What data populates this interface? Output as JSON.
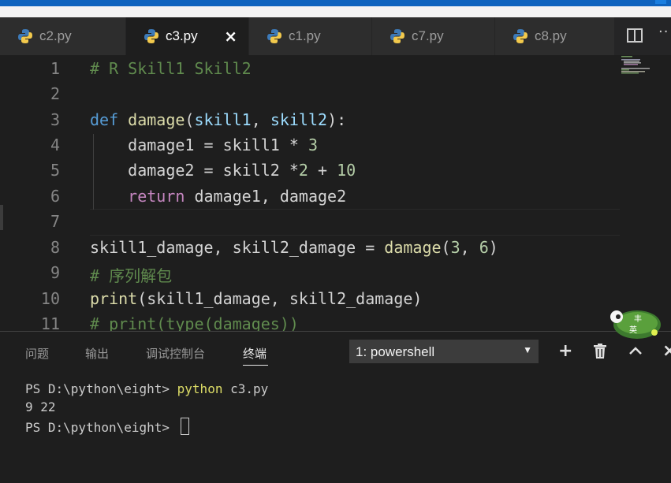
{
  "window": {
    "accent_color": "#0e63be"
  },
  "tabs": [
    {
      "label": "c2.py",
      "icon": "python-icon",
      "active": false
    },
    {
      "label": "c3.py",
      "icon": "python-icon",
      "active": true,
      "close": "×"
    },
    {
      "label": "c1.py",
      "icon": "python-icon",
      "active": false
    },
    {
      "label": "c7.py",
      "icon": "python-icon",
      "active": false
    },
    {
      "label": "c8.py",
      "icon": "python-icon",
      "active": false
    }
  ],
  "editor_actions": {
    "split_icon": "split-editor-icon",
    "more": "··"
  },
  "editor": {
    "line_numbers": [
      "1",
      "2",
      "3",
      "4",
      "5",
      "6",
      "7",
      "8",
      "9",
      "10",
      "11"
    ],
    "lines": {
      "l1": "# R Skill1 Skill2",
      "l3_def": "def",
      "l3_fn": "damage",
      "l3_p1": "skill1",
      "l3_p2": "skill2",
      "l4_a": "damage1 = skill1 * ",
      "l4_n": "3",
      "l5_a": "damage2 = skill2 *",
      "l5_n1": "2",
      "l5_b": " + ",
      "l5_n2": "10",
      "l6_ret": "return",
      "l6_rest": " damage1, damage2",
      "l8_a": "skill1_damage, skill2_damage = ",
      "l8_fn": "damage",
      "l8_n1": "3",
      "l8_n2": "6",
      "l9": "# 序列解包",
      "l10_fn": "print",
      "l10_rest": "(skill1_damage, skill2_damage)",
      "l11": "# print(type(damages))"
    }
  },
  "panel": {
    "tabs": [
      "问题",
      "输出",
      "调试控制台",
      "终端"
    ],
    "active_tab": "终端",
    "terminal_select": "1: powershell",
    "buttons": {
      "add": "+",
      "trash": "trash-icon",
      "maximize": "^",
      "close": "×"
    }
  },
  "terminal": {
    "prompt": "PS D:\\python\\eight> ",
    "command": "python",
    "command_arg": " c3.py",
    "output": "9 22",
    "prompt2": "PS D:\\python\\eight> "
  },
  "sticker": {
    "text_top": "丰",
    "text_bottom": "英"
  }
}
